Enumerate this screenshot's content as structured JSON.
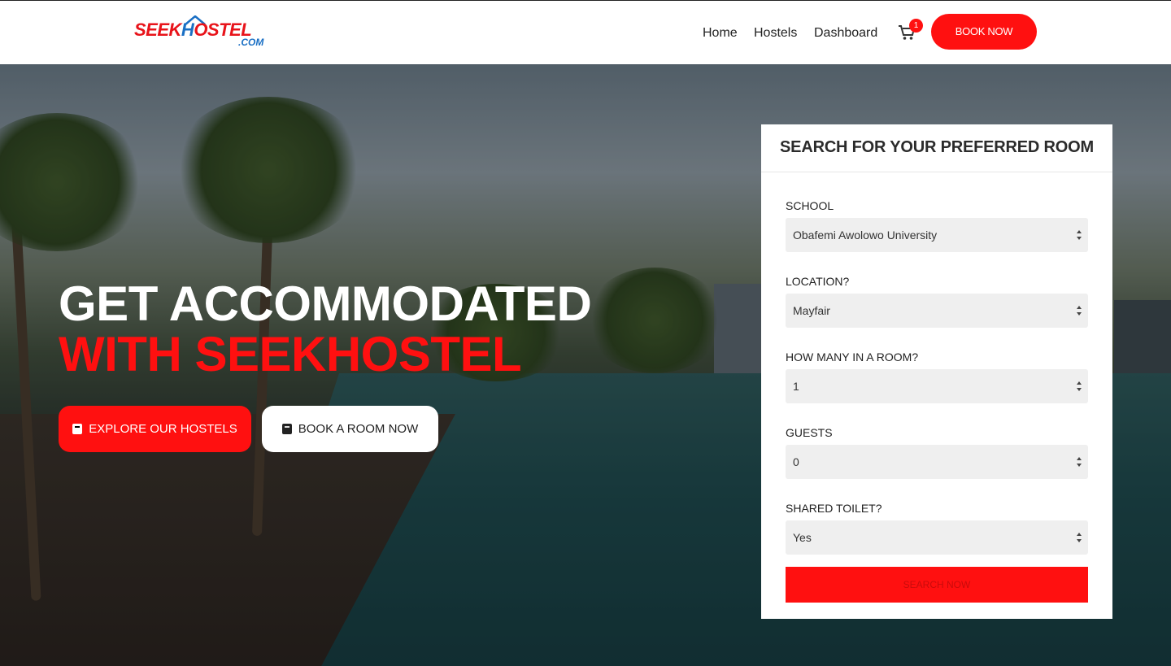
{
  "header": {
    "logo": {
      "text_main": "SEEK",
      "text_h": "H",
      "text_rest": "OSTEL",
      "text_sub": ".COM"
    },
    "nav": [
      {
        "label": "Home"
      },
      {
        "label": "Hostels"
      },
      {
        "label": "Dashboard"
      }
    ],
    "cart": {
      "icon": "shopping-cart-icon",
      "count": "1"
    },
    "book_now_label": "BOOK NOW"
  },
  "hero": {
    "headline_line1": "GET ACCOMMODATED",
    "headline_line2": "WITH SEEKHOSTEL",
    "explore_button": {
      "label": "EXPLORE OUR HOSTELS",
      "icon": "book-icon"
    },
    "book_room_button": {
      "label": "BOOK A ROOM NOW",
      "icon": "book-icon"
    }
  },
  "search_panel": {
    "title": "SEARCH FOR YOUR PREFERRED ROOM",
    "fields": [
      {
        "label": "SCHOOL",
        "value": "Obafemi Awolowo University"
      },
      {
        "label": "LOCATION?",
        "value": "Mayfair"
      },
      {
        "label": "HOW MANY IN A ROOM?",
        "value": "1"
      },
      {
        "label": "GUESTS",
        "value": "0"
      },
      {
        "label": "SHARED TOILET?",
        "value": "Yes"
      }
    ],
    "search_button_label": "SEARCH NOW"
  },
  "colors": {
    "accent_red": "#ff1010",
    "logo_blue": "#1a6fc4",
    "panel_bg": "#ffffff",
    "select_bg": "#efefef"
  }
}
